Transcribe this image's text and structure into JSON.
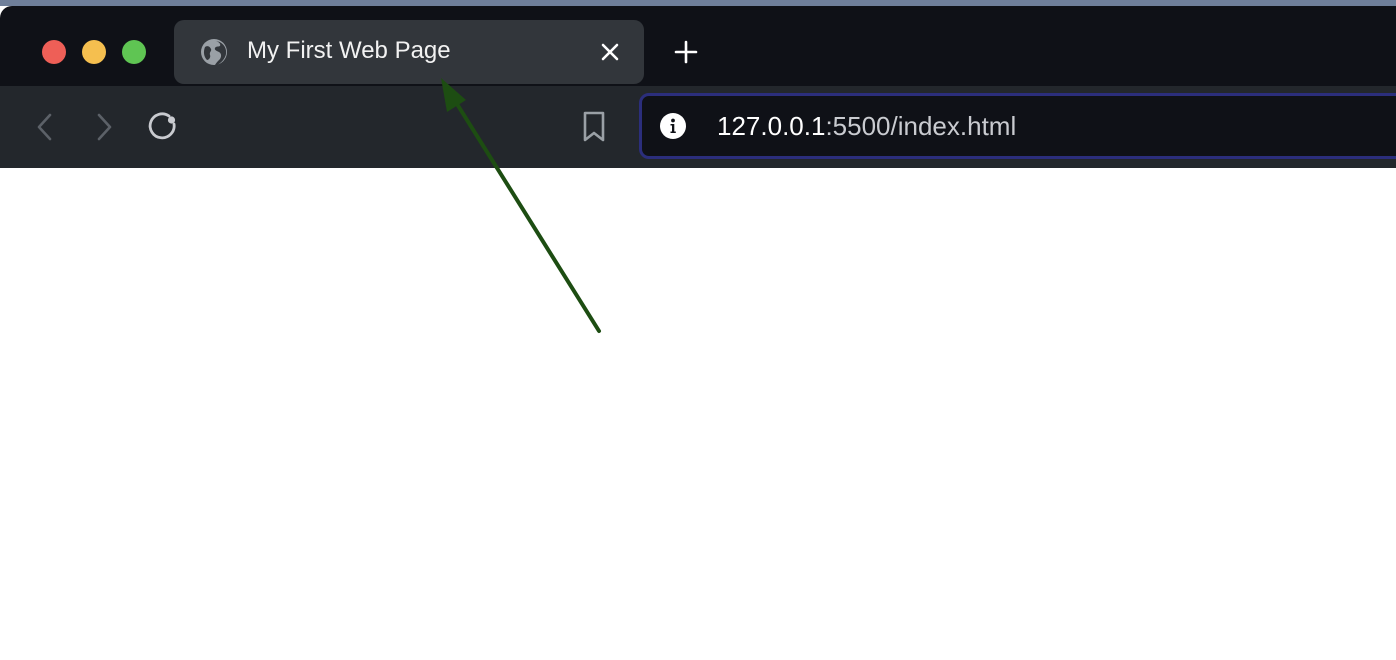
{
  "browser": {
    "tab": {
      "title": "My First Web Page",
      "icon": "globe-icon",
      "close_icon": "close-icon"
    },
    "new_tab_icon": "plus-icon",
    "toolbar": {
      "back_icon": "chevron-left-icon",
      "forward_icon": "chevron-right-icon",
      "reload_icon": "reload-icon",
      "bookmark_icon": "bookmark-icon"
    },
    "address_bar": {
      "info_icon": "info-icon",
      "url_host": "127.0.0.1",
      "url_rest": ":5500/index.html"
    },
    "window_controls": {
      "close_color": "#ee5f57",
      "minimize_color": "#f5bf4f",
      "maximize_color": "#5fc553"
    }
  },
  "annotation": {
    "arrow_color": "#1d4d12"
  },
  "colors": {
    "titlebar": "#0f1117",
    "tab_active": "#32363b",
    "toolbar": "#23272c",
    "urlbar_border": "#2b2e7c",
    "page_background": "#ffffff"
  }
}
